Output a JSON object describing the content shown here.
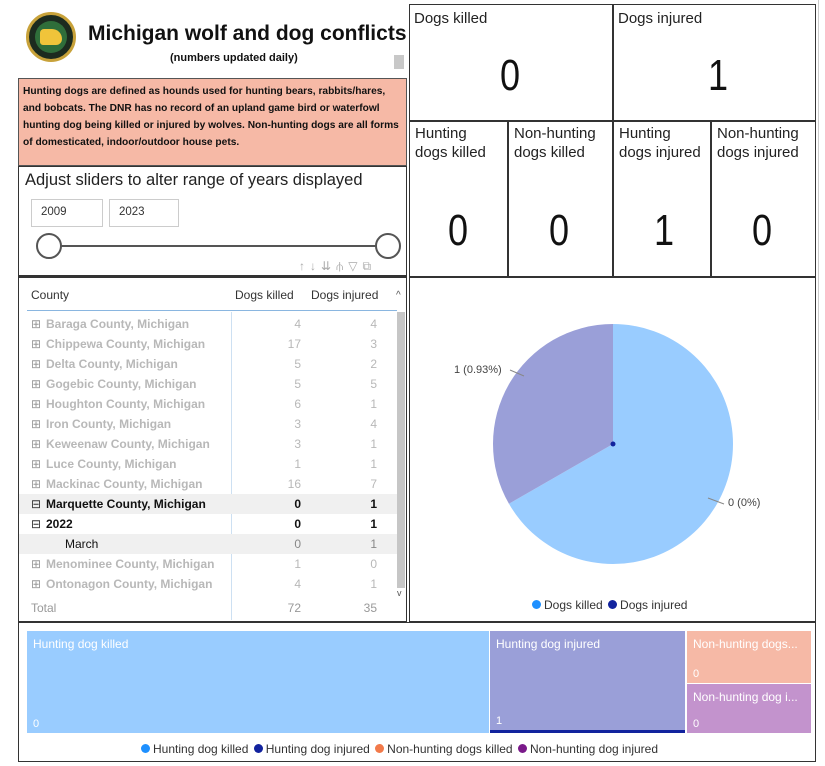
{
  "header": {
    "title": "Michigan wolf and dog conflicts",
    "subtitle": "(numbers updated daily)",
    "logo_text": "DEPARTMENT OF NATURAL RESOURCES · MICHIGAN"
  },
  "note": {
    "text": "Hunting dogs are defined as hounds used for hunting bears, rabbits/hares, and bobcats. The DNR has no record of an upland game bird or waterfowl hunting dog being killed or injured by wolves. Non-hunting dogs are all forms of domesticated, indoor/outdoor house pets."
  },
  "slider": {
    "title": "Adjust sliders to alter range of years displayed",
    "start_year": "2009",
    "end_year": "2023"
  },
  "kpis": {
    "dogs_killed": {
      "label": "Dogs killed",
      "value": "0"
    },
    "dogs_injured": {
      "label": "Dogs injured",
      "value": "1"
    },
    "hunting_killed": {
      "label1": "Hunting",
      "label2": "dogs killed",
      "value": "0"
    },
    "nonhunting_killed": {
      "label1": "Non-hunting",
      "label2": "dogs killed",
      "value": "0"
    },
    "hunting_injured": {
      "label1": "Hunting",
      "label2": "dogs injured",
      "value": "1"
    },
    "nonhunting_injured": {
      "label1": "Non-hunting",
      "label2": "dogs injured",
      "value": "0"
    }
  },
  "table": {
    "headers": [
      "County",
      "Dogs killed",
      "Dogs injured"
    ],
    "rows": [
      {
        "name": "Baraga County, Michigan",
        "killed": "4",
        "injured": "4",
        "style": "dim",
        "icon": "⊞"
      },
      {
        "name": "Chippewa County, Michigan",
        "killed": "17",
        "injured": "3",
        "style": "dim",
        "icon": "⊞"
      },
      {
        "name": "Delta County, Michigan",
        "killed": "5",
        "injured": "2",
        "style": "dim",
        "icon": "⊞"
      },
      {
        "name": "Gogebic County, Michigan",
        "killed": "5",
        "injured": "5",
        "style": "dim",
        "icon": "⊞"
      },
      {
        "name": "Houghton County, Michigan",
        "killed": "6",
        "injured": "1",
        "style": "dim",
        "icon": "⊞"
      },
      {
        "name": "Iron County, Michigan",
        "killed": "3",
        "injured": "4",
        "style": "dim",
        "icon": "⊞"
      },
      {
        "name": "Keweenaw County, Michigan",
        "killed": "3",
        "injured": "1",
        "style": "dim",
        "icon": "⊞"
      },
      {
        "name": "Luce County, Michigan",
        "killed": "1",
        "injured": "1",
        "style": "dim",
        "icon": "⊞"
      },
      {
        "name": "Mackinac County, Michigan",
        "killed": "16",
        "injured": "7",
        "style": "dim",
        "icon": "⊞"
      },
      {
        "name": "Marquette County, Michigan",
        "killed": "0",
        "injured": "1",
        "style": "hi sel",
        "icon": "⊟"
      },
      {
        "name": "2022",
        "killed": "0",
        "injured": "1",
        "style": "hi",
        "icon": "⊟",
        "indent": 1
      },
      {
        "name": "March",
        "killed": "0",
        "injured": "1",
        "style": "hi sel leaf",
        "icon": "",
        "indent": 2
      },
      {
        "name": "Menominee County, Michigan",
        "killed": "1",
        "injured": "0",
        "style": "dim",
        "icon": "⊞"
      },
      {
        "name": "Ontonagon County, Michigan",
        "killed": "4",
        "injured": "1",
        "style": "dim",
        "icon": "⊞"
      }
    ],
    "total": {
      "label": "Total",
      "killed": "72",
      "injured": "35"
    }
  },
  "pie": {
    "slices": [
      {
        "name": "Dogs killed",
        "value": 0,
        "label": "0 (0%)",
        "color": "#99ccff"
      },
      {
        "name": "Dogs injured",
        "value": 1,
        "label": "1 (0.93%)",
        "color": "#9a9fd8"
      }
    ],
    "legend": [
      {
        "name": "Dogs killed",
        "color": "#1e90ff"
      },
      {
        "name": "Dogs injured",
        "color": "#12239e"
      }
    ]
  },
  "treemap": {
    "tiles": [
      {
        "label": "Hunting dog killed",
        "value": "0",
        "color": "#99ccff"
      },
      {
        "label": "Hunting dog injured",
        "value": "1",
        "color": "#9a9fd8"
      },
      {
        "label": "Non-hunting dogs...",
        "value": "0",
        "color": "#f6b9a6"
      },
      {
        "label": "Non-hunting dog i...",
        "value": "0",
        "color": "#c393cd"
      }
    ],
    "legend": [
      {
        "name": "Hunting dog killed",
        "color": "#1e90ff"
      },
      {
        "name": "Hunting dog injured",
        "color": "#12239e"
      },
      {
        "name": "Non-hunting dogs killed",
        "color": "#f27a4a"
      },
      {
        "name": "Non-hunting dog injured",
        "color": "#7a1a8a"
      }
    ]
  }
}
